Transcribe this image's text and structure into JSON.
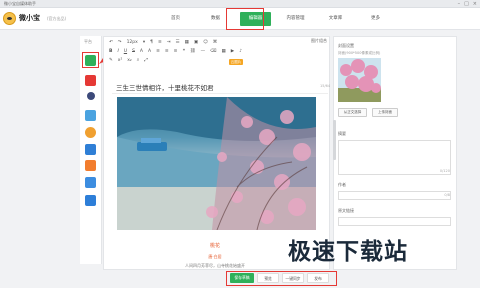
{
  "window": {
    "title": "微小宝自媒体助手"
  },
  "header": {
    "brand": "微小宝",
    "brand_sub": "(官方出品)",
    "nav": [
      {
        "label": "首页",
        "active": false
      },
      {
        "label": "数据",
        "active": false
      },
      {
        "label": "编辑器",
        "active": true
      },
      {
        "label": "内容管理",
        "active": false
      },
      {
        "label": "文章库",
        "active": false
      },
      {
        "label": "更多",
        "active": false
      }
    ]
  },
  "platforms": {
    "label": "平台",
    "icons": [
      "wechat-icon",
      "toutiao-icon",
      "baijia-icon",
      "qq-icon",
      "weibo-icon",
      "yidian-icon",
      "sohu-icon",
      "qq-kandian-icon",
      "zhihu-icon"
    ],
    "colors": [
      "#2fb05a",
      "#e53935",
      "#3c4a7a",
      "#4aa3e0",
      "#f0a030",
      "#2f7fd6",
      "#f27d2e",
      "#3c8de0",
      "#2d7ed8"
    ]
  },
  "toolbar": {
    "font_size": "12px",
    "link": "图片组合",
    "orange_label": "云图片"
  },
  "editor": {
    "headline": "三生三世情相许，十里桃花不如君",
    "wordcount": "15/64",
    "caption1": "桃花",
    "caption2": "唐·白居",
    "caption3": "人间四月芳菲尽，山寺桃花始盛开"
  },
  "right": {
    "cover_title": "封面设置",
    "cover_sub": "封面(900*500像素或比例)",
    "btn_library": "从正文选择",
    "btn_upload": "上传封面",
    "summary_label": "摘要",
    "summary_count": "0/120",
    "author_label": "作者",
    "author_count": "0/8",
    "source_label": "原文链接"
  },
  "footer": {
    "buttons": [
      {
        "label": "保存草稿",
        "primary": true
      },
      {
        "label": "预览",
        "primary": false
      },
      {
        "label": "一键同步",
        "primary": false
      },
      {
        "label": "发布",
        "primary": false
      }
    ]
  },
  "watermark": "极速下载站"
}
